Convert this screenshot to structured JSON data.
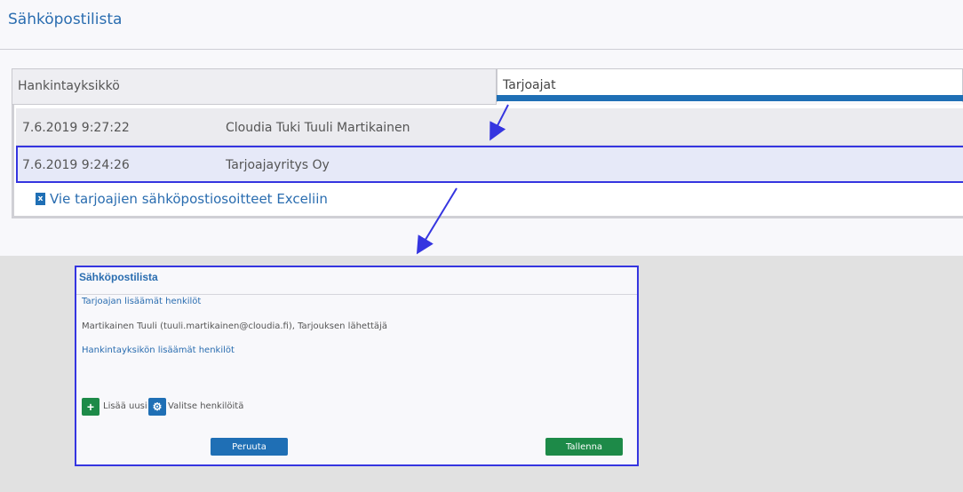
{
  "page": {
    "title": "Sähköpostilista"
  },
  "tabs": {
    "left": "Hankintayksikkö",
    "right": "Tarjoajat"
  },
  "list": {
    "rows": [
      {
        "date": "7.6.2019 9:27:22",
        "name": "Cloudia Tuki Tuuli Martikainen"
      },
      {
        "date": "7.6.2019 9:24:26",
        "name": "Tarjoajayritys Oy"
      }
    ],
    "excel_link": "Vie tarjoajien sähköpostiosoitteet Exceliin",
    "excel_icon_glyph": "x"
  },
  "dialog": {
    "title": "Sähköpostilista",
    "section_bidder": "Tarjoajan lisäämät henkilöt",
    "person": "Martikainen Tuuli (tuuli.martikainen@cloudia.fi), Tarjouksen lähettäjä",
    "section_unit": "Hankintayksikön lisäämät henkilöt",
    "add_label": "Lisää uusi",
    "select_label": "Valitse henkilöitä",
    "add_glyph": "+",
    "gear_glyph": "⚙",
    "cancel": "Peruuta",
    "save": "Tallenna"
  },
  "colors": {
    "accent_blue": "#1f6fb5",
    "save_green": "#1d8a48",
    "annotation": "#3535e0"
  }
}
